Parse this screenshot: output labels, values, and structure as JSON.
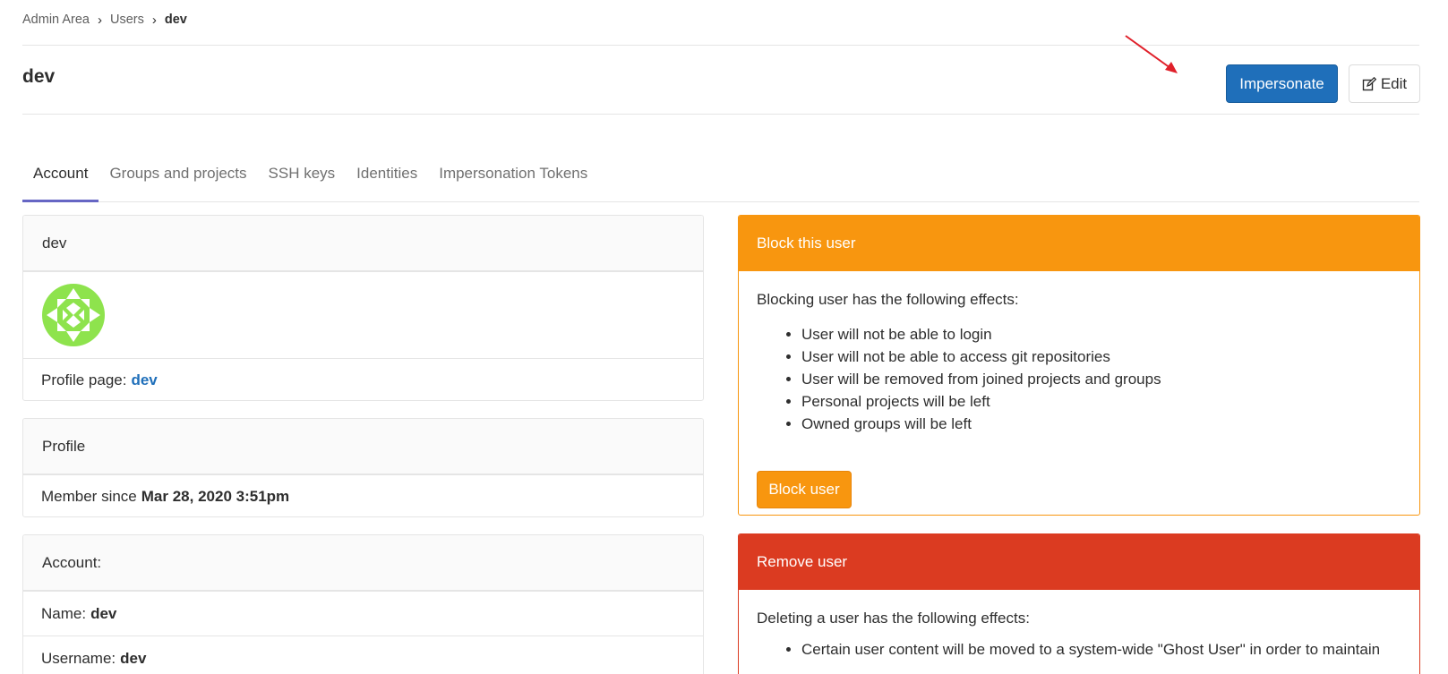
{
  "breadcrumb": {
    "items": [
      "Admin Area",
      "Users"
    ],
    "separator": "›",
    "current": "dev"
  },
  "page": {
    "title": "dev"
  },
  "actions": {
    "impersonate_label": "Impersonate",
    "edit_label": "Edit",
    "edit_icon": "edit-icon"
  },
  "tabs": [
    {
      "label": "Account",
      "active": true
    },
    {
      "label": "Groups and projects",
      "active": false
    },
    {
      "label": "SSH keys",
      "active": false
    },
    {
      "label": "Identities",
      "active": false
    },
    {
      "label": "Impersonation Tokens",
      "active": false
    }
  ],
  "user_card": {
    "header": "dev",
    "avatar_color": "#8ee34d",
    "profile_label": "Profile page:",
    "profile_link": "dev"
  },
  "profile_card": {
    "header": "Profile",
    "member_since_label": "Member since",
    "member_since_value": "Mar 28, 2020 3:51pm"
  },
  "account_card": {
    "header": "Account:",
    "name_label": "Name:",
    "name_value": "dev",
    "username_label": "Username:",
    "username_value": "dev"
  },
  "block_panel": {
    "header": "Block this user",
    "intro": "Blocking user has the following effects:",
    "effects": [
      "User will not be able to login",
      "User will not be able to access git repositories",
      "User will be removed from joined projects and groups",
      "Personal projects will be left",
      "Owned groups will be left"
    ],
    "button_label": "Block user",
    "color": "#f8960f"
  },
  "remove_panel": {
    "header": "Remove user",
    "intro": "Deleting a user has the following effects:",
    "effects": [
      "Certain user content will be moved to a system-wide \"Ghost User\" in order to maintain"
    ],
    "color": "#db3b21"
  },
  "colors": {
    "primary": "#1f6fba",
    "tab_active": "#6666c4",
    "annotation_arrow": "#e0202a"
  }
}
